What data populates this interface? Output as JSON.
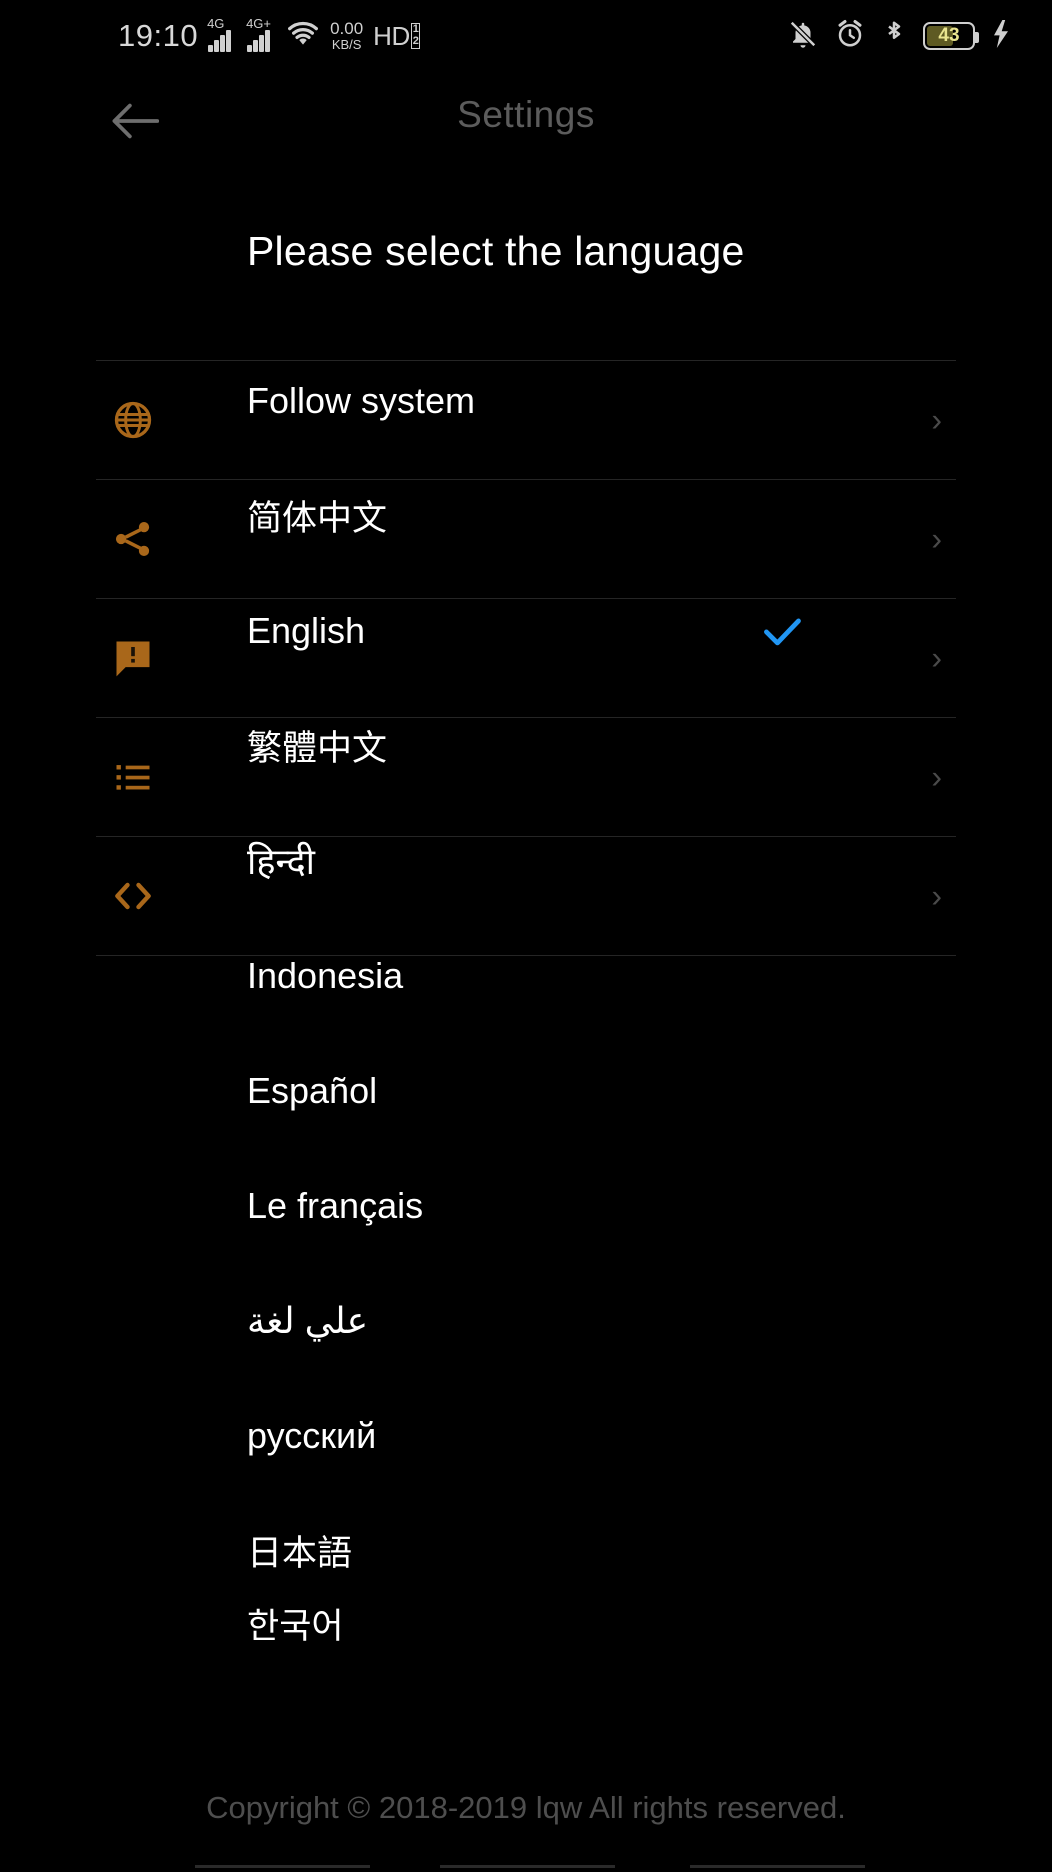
{
  "status_bar": {
    "clock": "19:10",
    "signal_1_label": "4G",
    "signal_2_label": "4G+",
    "net_speed_value": "0.00",
    "net_speed_unit": "KB/S",
    "hd_label": "HD",
    "hd_sub_top": "1",
    "hd_sub_bottom": "2",
    "battery_percent": "43",
    "icons": [
      "wifi-icon",
      "notifications-off-icon",
      "alarm-icon",
      "bluetooth-icon",
      "battery-icon",
      "charging-bolt-icon"
    ]
  },
  "app_bar": {
    "back_icon": "arrow-left-icon",
    "title": "Settings"
  },
  "background_settings_rows": [
    {
      "icon": "globe-icon",
      "chevron": "›"
    },
    {
      "icon": "share-icon",
      "chevron": "›"
    },
    {
      "icon": "feedback-icon",
      "chevron": "›"
    },
    {
      "icon": "list-icon",
      "chevron": "›"
    },
    {
      "icon": "code-icon",
      "chevron": "›"
    }
  ],
  "language_dialog": {
    "title": "Please select the language",
    "selected": "English",
    "check_color": "#2196f3",
    "items": [
      {
        "label": "Follow system",
        "checked": false
      },
      {
        "label": "简体中文",
        "checked": false
      },
      {
        "label": "English",
        "checked": true
      },
      {
        "label": "繁體中文",
        "checked": false
      },
      {
        "label": "हिन्दी",
        "checked": false
      },
      {
        "label": "Indonesia",
        "checked": false
      },
      {
        "label": "Español",
        "checked": false
      },
      {
        "label": "Le français",
        "checked": false
      },
      {
        "label": "علي لغة",
        "checked": false
      },
      {
        "label": "русский",
        "checked": false
      },
      {
        "label": "日本語",
        "checked": false
      },
      {
        "label": "한국어",
        "checked": false
      }
    ]
  },
  "footer": {
    "copyright": "Copyright © 2018-2019 lqw All rights reserved."
  },
  "colors": {
    "background": "#000000",
    "accent_orange": "#a9671a",
    "text_primary": "#ffffff",
    "text_dim": "#5c5c5c",
    "divider": "#252525"
  }
}
